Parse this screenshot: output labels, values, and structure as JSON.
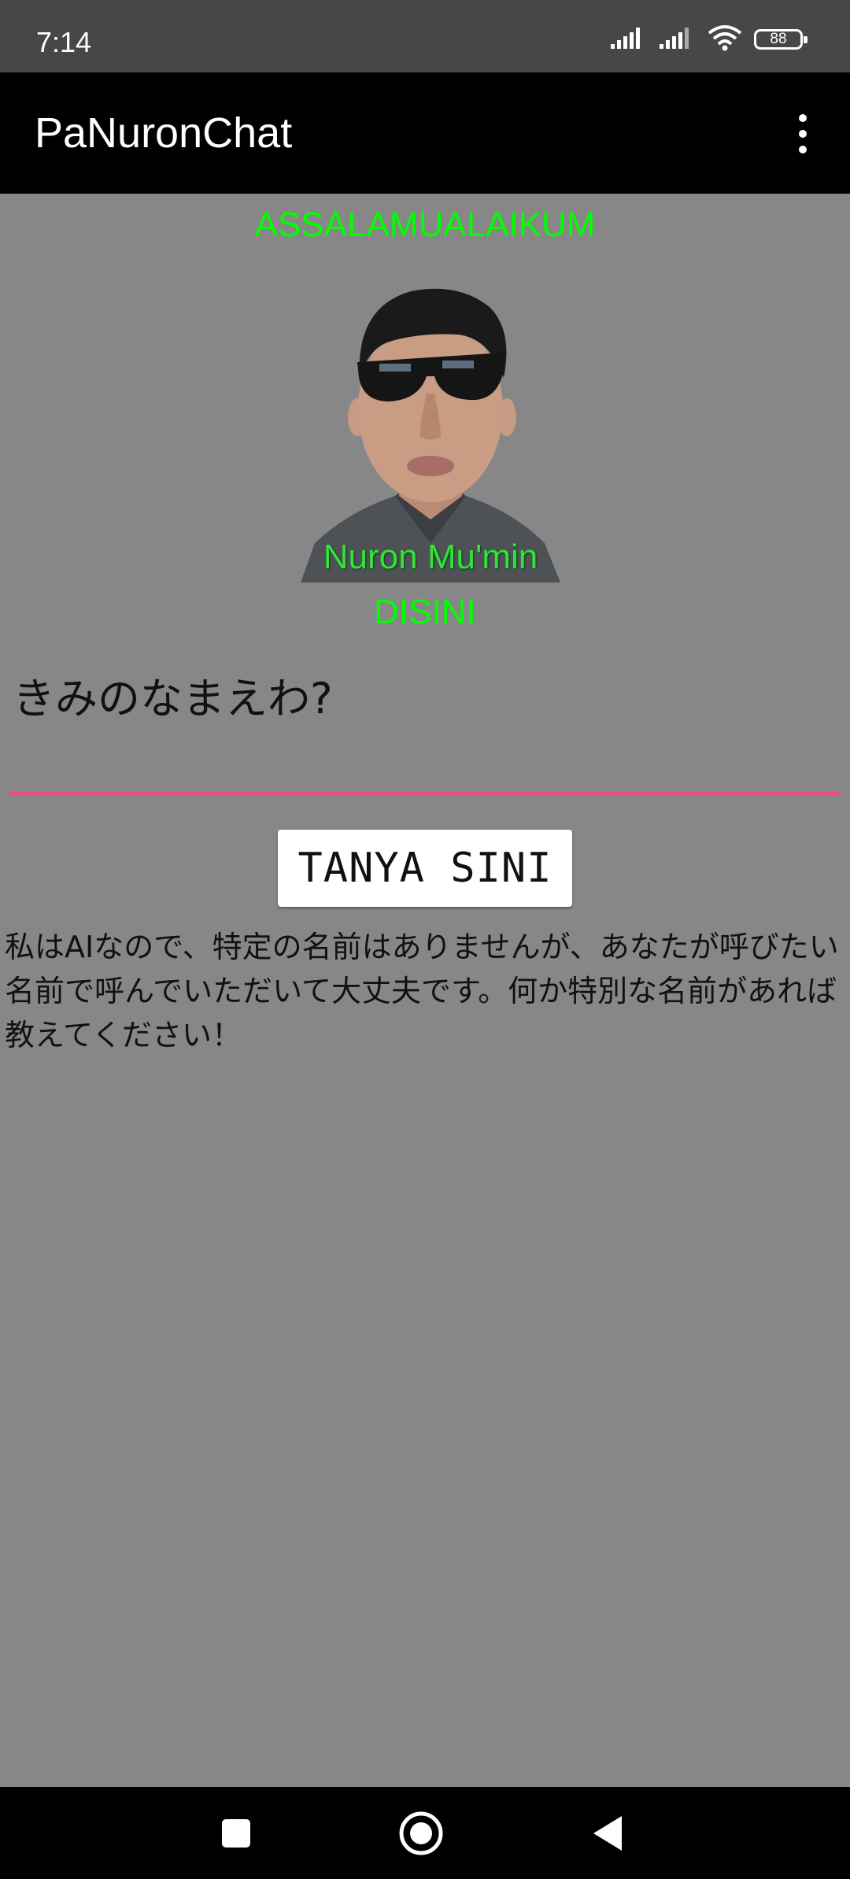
{
  "status_bar": {
    "time": "7:14",
    "battery": "88",
    "icons": [
      "signal-icon",
      "signal-icon",
      "wifi-icon",
      "battery-icon"
    ]
  },
  "app_bar": {
    "title": "PaNuronChat",
    "menu_icon": "more-vert-icon"
  },
  "main": {
    "greeting": "ASSALAMUALAIKUM",
    "avatar_caption": "Nuron Mu'min",
    "disini": "DISINI",
    "input_value": "きみのなまえわ?",
    "ask_button": "TANYA SINI",
    "answer": "私はAIなので、特定の名前はありませんが、あなたが呼びたい名前で呼んでいただいて大丈夫です。何か特別な名前があれば教えてください！"
  },
  "colors": {
    "background": "#878787",
    "status_bar": "#474747",
    "app_bar": "#000000",
    "accent_green": "#00ff00",
    "input_underline": "#e8527a"
  },
  "nav_bar": {
    "icons": [
      "recents-icon",
      "home-icon",
      "back-icon"
    ]
  }
}
